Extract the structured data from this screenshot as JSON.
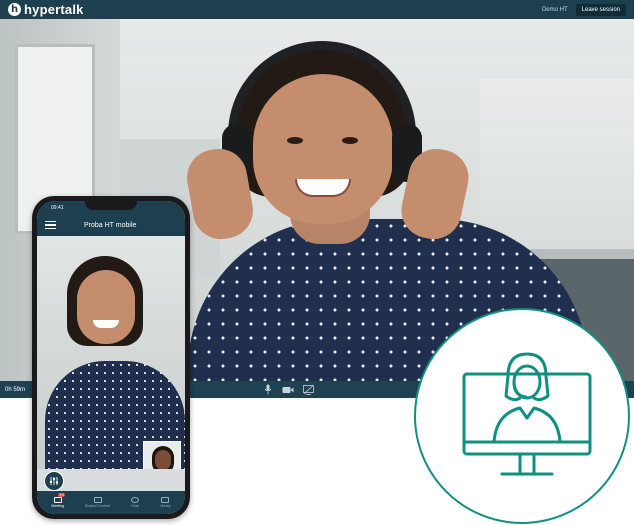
{
  "app": {
    "logo_mark": "h",
    "brand": "hypertalk",
    "session_name": "Demo HT",
    "leave_label": "Leave session"
  },
  "video": {
    "elapsed": "0h 59m"
  },
  "controls": [
    "mic-icon",
    "camera-icon",
    "screen-share-icon"
  ],
  "mobile": {
    "status_time": "09:41",
    "title": "Proba HT mobile",
    "tabs": [
      {
        "label": "Meeting",
        "icon": "meeting-icon",
        "badge": "1:0"
      },
      {
        "label": "Shared Content",
        "icon": "shared-content-icon"
      },
      {
        "label": "Chat",
        "icon": "chat-icon"
      },
      {
        "label": "Library",
        "icon": "library-icon"
      }
    ]
  },
  "colors": {
    "bar": "#1d3f4f",
    "accent_teal": "#10907f",
    "badge_red": "#e5483e"
  },
  "illustration": {
    "icon": "online-consultant-monitor-icon"
  }
}
